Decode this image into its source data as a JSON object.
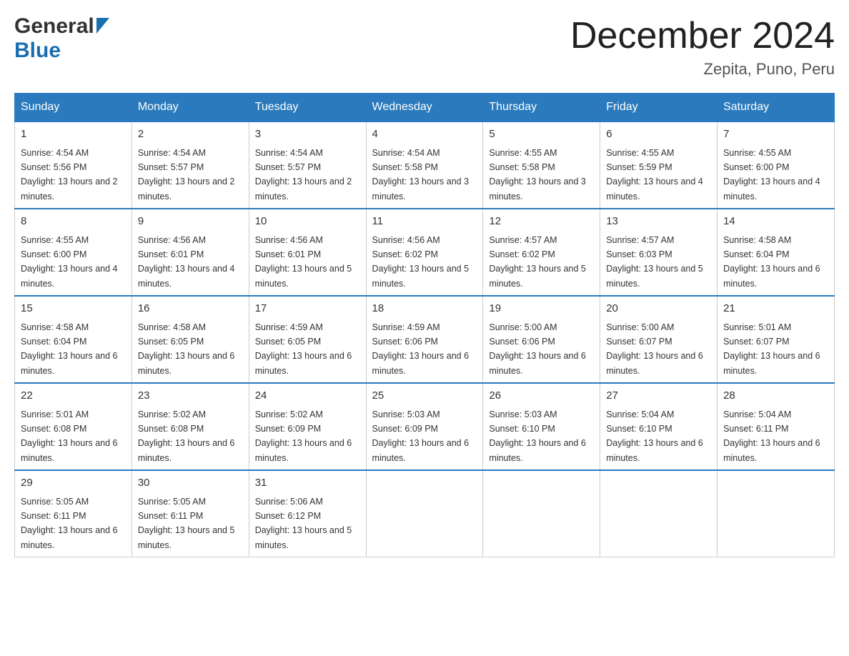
{
  "header": {
    "title": "December 2024",
    "subtitle": "Zepita, Puno, Peru",
    "logo_general": "General",
    "logo_blue": "Blue"
  },
  "days_of_week": [
    "Sunday",
    "Monday",
    "Tuesday",
    "Wednesday",
    "Thursday",
    "Friday",
    "Saturday"
  ],
  "weeks": [
    [
      {
        "day": "1",
        "sunrise": "4:54 AM",
        "sunset": "5:56 PM",
        "daylight": "13 hours and 2 minutes."
      },
      {
        "day": "2",
        "sunrise": "4:54 AM",
        "sunset": "5:57 PM",
        "daylight": "13 hours and 2 minutes."
      },
      {
        "day": "3",
        "sunrise": "4:54 AM",
        "sunset": "5:57 PM",
        "daylight": "13 hours and 2 minutes."
      },
      {
        "day": "4",
        "sunrise": "4:54 AM",
        "sunset": "5:58 PM",
        "daylight": "13 hours and 3 minutes."
      },
      {
        "day": "5",
        "sunrise": "4:55 AM",
        "sunset": "5:58 PM",
        "daylight": "13 hours and 3 minutes."
      },
      {
        "day": "6",
        "sunrise": "4:55 AM",
        "sunset": "5:59 PM",
        "daylight": "13 hours and 4 minutes."
      },
      {
        "day": "7",
        "sunrise": "4:55 AM",
        "sunset": "6:00 PM",
        "daylight": "13 hours and 4 minutes."
      }
    ],
    [
      {
        "day": "8",
        "sunrise": "4:55 AM",
        "sunset": "6:00 PM",
        "daylight": "13 hours and 4 minutes."
      },
      {
        "day": "9",
        "sunrise": "4:56 AM",
        "sunset": "6:01 PM",
        "daylight": "13 hours and 4 minutes."
      },
      {
        "day": "10",
        "sunrise": "4:56 AM",
        "sunset": "6:01 PM",
        "daylight": "13 hours and 5 minutes."
      },
      {
        "day": "11",
        "sunrise": "4:56 AM",
        "sunset": "6:02 PM",
        "daylight": "13 hours and 5 minutes."
      },
      {
        "day": "12",
        "sunrise": "4:57 AM",
        "sunset": "6:02 PM",
        "daylight": "13 hours and 5 minutes."
      },
      {
        "day": "13",
        "sunrise": "4:57 AM",
        "sunset": "6:03 PM",
        "daylight": "13 hours and 5 minutes."
      },
      {
        "day": "14",
        "sunrise": "4:58 AM",
        "sunset": "6:04 PM",
        "daylight": "13 hours and 6 minutes."
      }
    ],
    [
      {
        "day": "15",
        "sunrise": "4:58 AM",
        "sunset": "6:04 PM",
        "daylight": "13 hours and 6 minutes."
      },
      {
        "day": "16",
        "sunrise": "4:58 AM",
        "sunset": "6:05 PM",
        "daylight": "13 hours and 6 minutes."
      },
      {
        "day": "17",
        "sunrise": "4:59 AM",
        "sunset": "6:05 PM",
        "daylight": "13 hours and 6 minutes."
      },
      {
        "day": "18",
        "sunrise": "4:59 AM",
        "sunset": "6:06 PM",
        "daylight": "13 hours and 6 minutes."
      },
      {
        "day": "19",
        "sunrise": "5:00 AM",
        "sunset": "6:06 PM",
        "daylight": "13 hours and 6 minutes."
      },
      {
        "day": "20",
        "sunrise": "5:00 AM",
        "sunset": "6:07 PM",
        "daylight": "13 hours and 6 minutes."
      },
      {
        "day": "21",
        "sunrise": "5:01 AM",
        "sunset": "6:07 PM",
        "daylight": "13 hours and 6 minutes."
      }
    ],
    [
      {
        "day": "22",
        "sunrise": "5:01 AM",
        "sunset": "6:08 PM",
        "daylight": "13 hours and 6 minutes."
      },
      {
        "day": "23",
        "sunrise": "5:02 AM",
        "sunset": "6:08 PM",
        "daylight": "13 hours and 6 minutes."
      },
      {
        "day": "24",
        "sunrise": "5:02 AM",
        "sunset": "6:09 PM",
        "daylight": "13 hours and 6 minutes."
      },
      {
        "day": "25",
        "sunrise": "5:03 AM",
        "sunset": "6:09 PM",
        "daylight": "13 hours and 6 minutes."
      },
      {
        "day": "26",
        "sunrise": "5:03 AM",
        "sunset": "6:10 PM",
        "daylight": "13 hours and 6 minutes."
      },
      {
        "day": "27",
        "sunrise": "5:04 AM",
        "sunset": "6:10 PM",
        "daylight": "13 hours and 6 minutes."
      },
      {
        "day": "28",
        "sunrise": "5:04 AM",
        "sunset": "6:11 PM",
        "daylight": "13 hours and 6 minutes."
      }
    ],
    [
      {
        "day": "29",
        "sunrise": "5:05 AM",
        "sunset": "6:11 PM",
        "daylight": "13 hours and 6 minutes."
      },
      {
        "day": "30",
        "sunrise": "5:05 AM",
        "sunset": "6:11 PM",
        "daylight": "13 hours and 5 minutes."
      },
      {
        "day": "31",
        "sunrise": "5:06 AM",
        "sunset": "6:12 PM",
        "daylight": "13 hours and 5 minutes."
      },
      null,
      null,
      null,
      null
    ]
  ],
  "labels": {
    "sunrise": "Sunrise:",
    "sunset": "Sunset:",
    "daylight": "Daylight:"
  }
}
